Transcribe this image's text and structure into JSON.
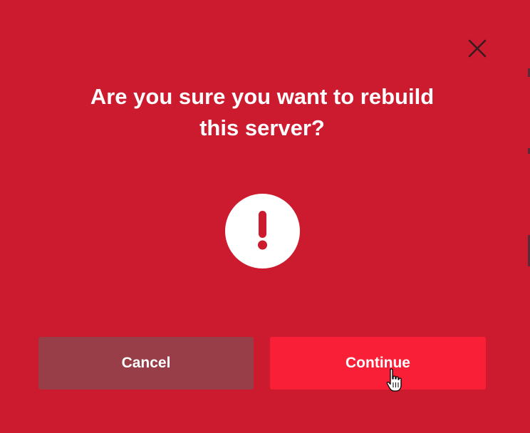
{
  "dialog": {
    "title_line1": "Are you sure you want to rebuild",
    "title_line2": "this server?",
    "close_icon": "close-icon",
    "alert_icon": "exclamation-circle-icon",
    "buttons": {
      "cancel_label": "Cancel",
      "continue_label": "Continue"
    }
  },
  "colors": {
    "background": "#cc1b2f",
    "cancel_button": "#983e49",
    "continue_button": "#f91f37",
    "text": "#ffffff",
    "close_icon": "#3a1a20"
  },
  "cursor": {
    "icon": "hand-pointer-icon"
  }
}
